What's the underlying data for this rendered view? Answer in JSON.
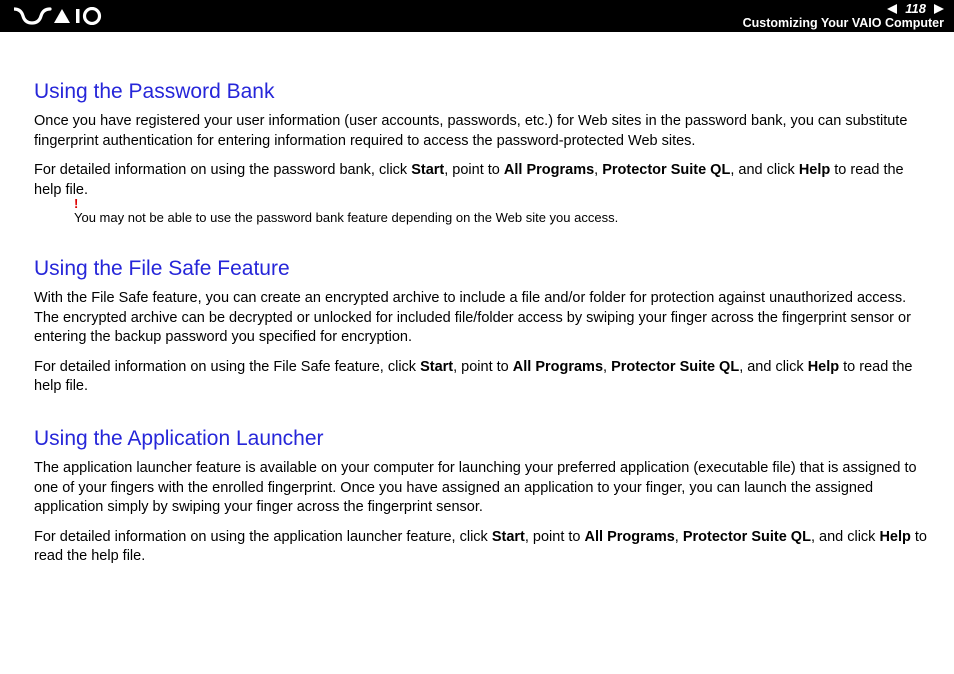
{
  "header": {
    "page_number": "118",
    "subtitle": "Customizing Your VAIO Computer"
  },
  "sections": {
    "pw_bank": {
      "title": "Using the Password Bank",
      "p1": "Once you have registered your user information (user accounts, passwords, etc.) for Web sites in the password bank, you can substitute fingerprint authentication for entering information required to access the password-protected Web sites.",
      "p2_a": "For detailed information on using the password bank, click ",
      "p2_b": ", point to ",
      "p2_c": ", ",
      "p2_d": ", and click ",
      "p2_e": " to read the help file.",
      "note_mark": "!",
      "note": "You may not be able to use the password bank feature depending on the Web site you access."
    },
    "file_safe": {
      "title": "Using the File Safe Feature",
      "p1": "With the File Safe feature, you can create an encrypted archive to include a file and/or folder for protection against unauthorized access. The encrypted archive can be decrypted or unlocked for included file/folder access by swiping your finger across the fingerprint sensor or entering the backup password you specified for encryption.",
      "p2_a": "For detailed information on using the File Safe feature, click ",
      "p2_b": ", point to ",
      "p2_c": ", ",
      "p2_d": ", and click ",
      "p2_e": " to read the help file."
    },
    "app_launcher": {
      "title": "Using the Application Launcher",
      "p1": "The application launcher feature is available on your computer for launching your preferred application (executable file) that is assigned to one of your fingers with the enrolled fingerprint. Once you have assigned an application to your finger, you can launch the assigned application simply by swiping your finger across the fingerprint sensor.",
      "p2_a": "For detailed information on using the application launcher feature, click ",
      "p2_b": ", point to ",
      "p2_c": ", ",
      "p2_d": ", and click ",
      "p2_e": " to read the help file."
    }
  },
  "bold_terms": {
    "start": "Start",
    "all_programs": "All Programs",
    "suite": "Protector Suite QL",
    "help": "Help"
  }
}
